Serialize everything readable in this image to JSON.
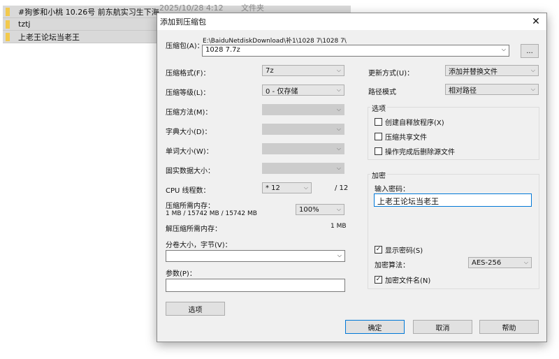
{
  "background": {
    "files": [
      {
        "name": "#狗爹和小桃 10.26号 前东航实习生下海...",
        "date": "2025/10/28 4:12",
        "type": "文件夹"
      },
      {
        "name": "tztj"
      },
      {
        "name": "上老王论坛当老王"
      }
    ]
  },
  "dialog": {
    "title": "添加到压缩包",
    "archive_label": "压缩包(A)：",
    "archive_path": "E:\\BaiduNetdiskDownload\\补1\\1028 7\\1028 7\\",
    "archive_name": "1028 7.7z",
    "browse": "...",
    "format_label": "压缩格式(F)：",
    "format": "7z",
    "level_label": "压缩等级(L)：",
    "level": "0 - 仅存储",
    "method_label": "压缩方法(M)：",
    "dict_label": "字典大小(D)：",
    "word_label": "单词大小(W)：",
    "solid_label": "固实数据大小：",
    "cpu_label": "CPU 线程数：",
    "cpu": "* 12",
    "cpu_max": "/ 12",
    "mem_label": "压缩所需内存：",
    "mem_value": "1 MB / 15742 MB / 15742 MB",
    "mem_pct": "100%",
    "unmem_label": "解压缩所需内存：",
    "unmem_value": "1 MB",
    "split_label": "分卷大小，字节(V)：",
    "split": "",
    "params_label": "参数(P)：",
    "params": "",
    "options_btn": "选项",
    "update_label": "更新方式(U)：",
    "update": "添加并替换文件",
    "path_label": "路径模式",
    "path_mode": "相对路径",
    "options_group": "选项",
    "opt_sfx": "创建自释放程序(X)",
    "opt_shared": "压缩共享文件",
    "opt_delete": "操作完成后删除源文件",
    "enc_group": "加密",
    "pwd_label": "输入密码：",
    "password": "上老王论坛当老王",
    "show_pwd": "显示密码(S)",
    "enc_method_label": "加密算法：",
    "enc_method": "AES-256",
    "enc_names": "加密文件名(N)",
    "ok": "确定",
    "cancel": "取消",
    "help": "帮助"
  }
}
